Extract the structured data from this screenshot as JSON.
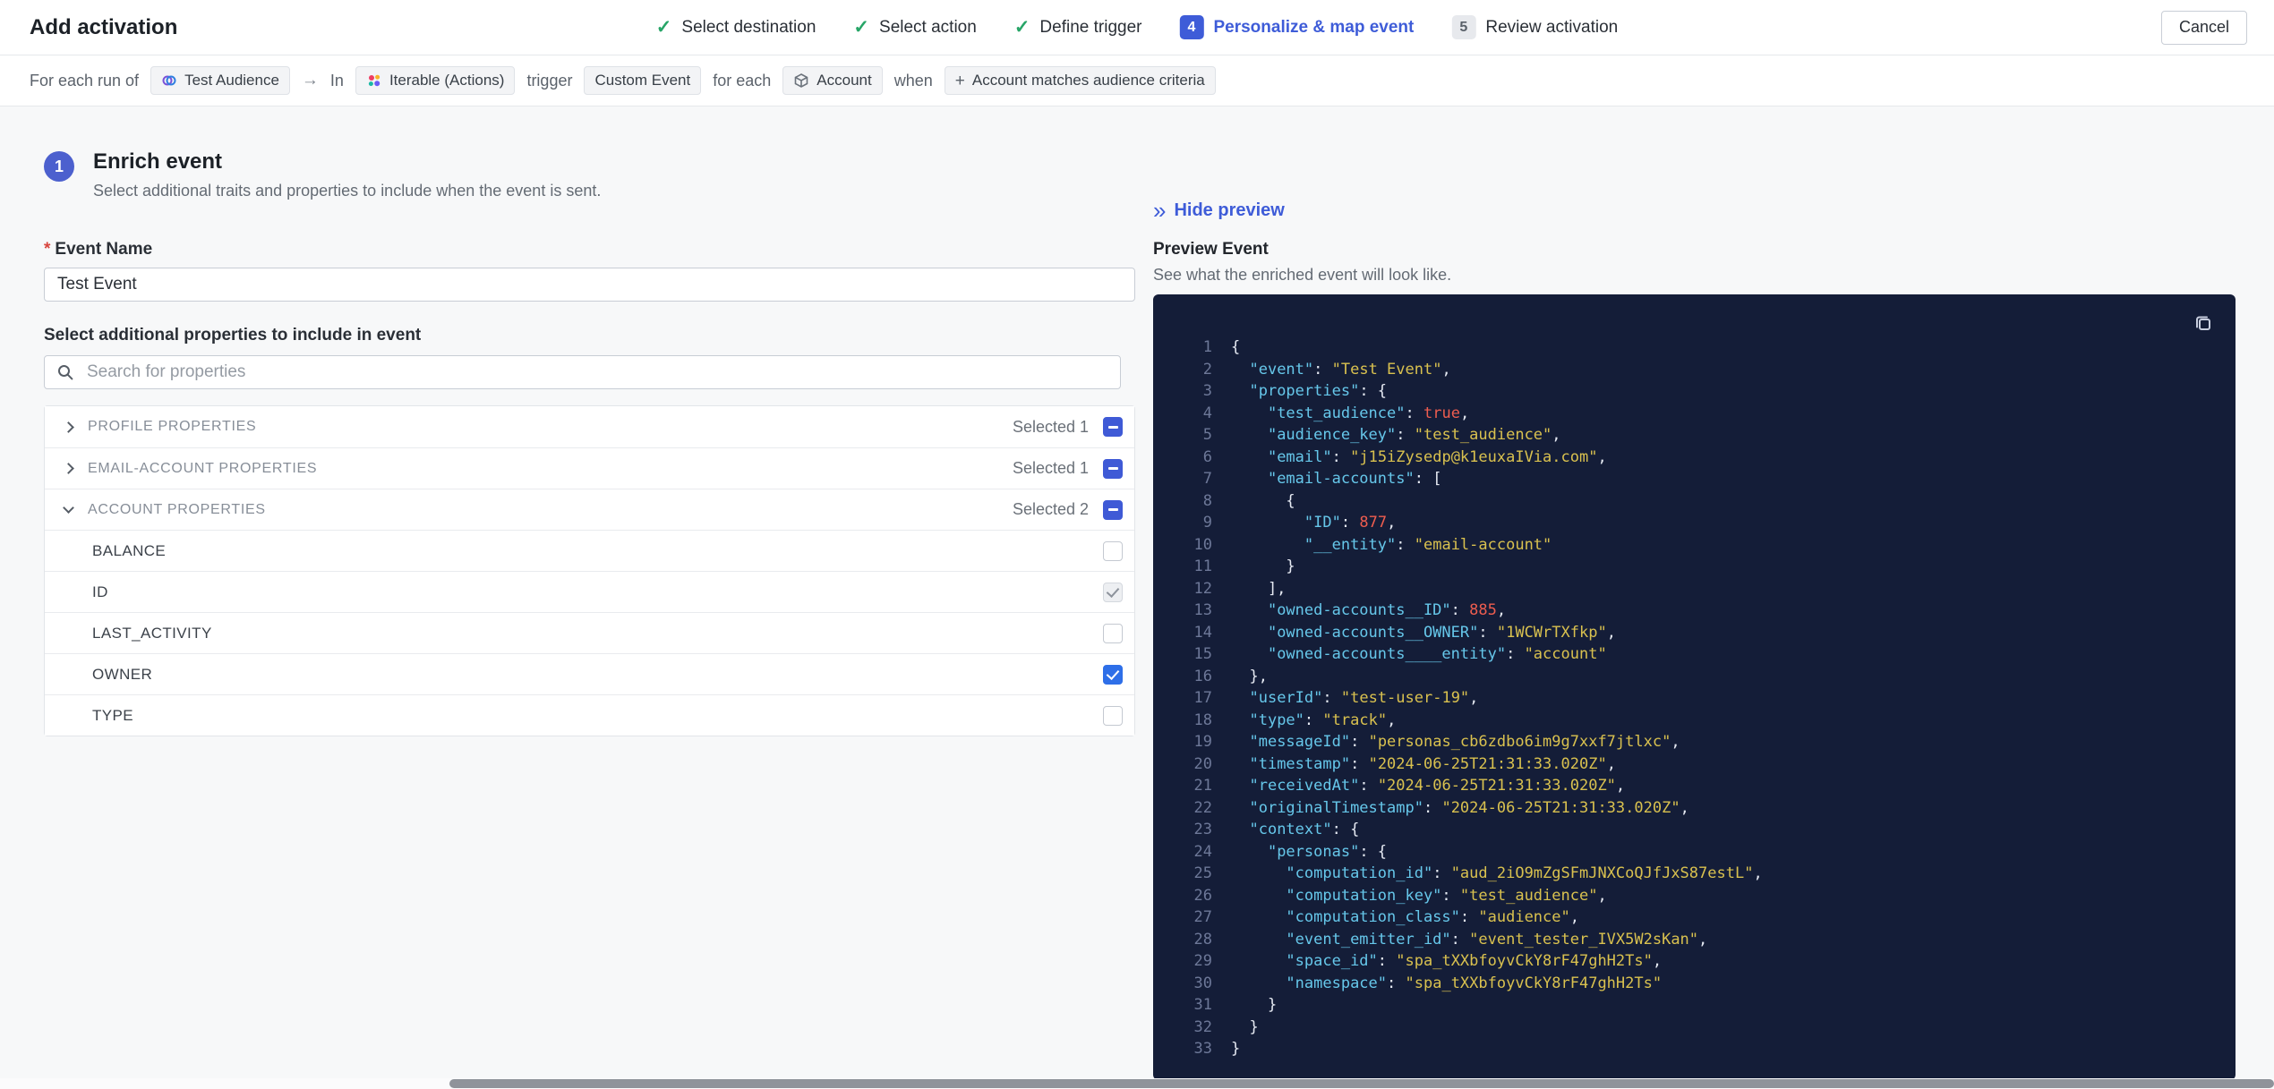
{
  "header": {
    "title": "Add activation",
    "cancel_label": "Cancel",
    "check_glyph": "✓",
    "steps": [
      {
        "label": "Select destination",
        "state": "done"
      },
      {
        "label": "Select action",
        "state": "done"
      },
      {
        "label": "Define trigger",
        "state": "done"
      },
      {
        "label": "Personalize & map event",
        "state": "active",
        "number": "4"
      },
      {
        "label": "Review activation",
        "state": "upcoming",
        "number": "5"
      }
    ]
  },
  "trigger_bar": {
    "prefix": "For each run of",
    "audience_chip": "Test Audience",
    "arrow": "→",
    "in_label": "In",
    "destination_chip": "Iterable (Actions)",
    "trigger_label": "trigger",
    "event_chip": "Custom Event",
    "for_each_label": "for each",
    "entity_chip": "Account",
    "when_label": "when",
    "criteria_plus": "+",
    "criteria_chip": "Account matches audience criteria"
  },
  "enrich": {
    "step_number": "1",
    "title": "Enrich event",
    "description": "Select additional traits and properties to include when the event is sent.",
    "event_name": {
      "required_mark": "*",
      "label": "Event Name",
      "value": "Test Event"
    },
    "properties_label": "Select additional properties to include in event",
    "search": {
      "placeholder": "Search for properties"
    },
    "groups": [
      {
        "label": "PROFILE PROPERTIES",
        "selected": "Selected 1",
        "checkbox": "indeterminate",
        "expanded": false
      },
      {
        "label": "EMAIL-ACCOUNT PROPERTIES",
        "selected": "Selected 1",
        "checkbox": "indeterminate",
        "expanded": false
      },
      {
        "label": "ACCOUNT PROPERTIES",
        "selected": "Selected 2",
        "checkbox": "indeterminate",
        "expanded": true
      }
    ],
    "account_items": [
      {
        "label": "BALANCE",
        "checkbox": "unchecked"
      },
      {
        "label": "ID",
        "checkbox": "checked-muted"
      },
      {
        "label": "LAST_ACTIVITY",
        "checkbox": "unchecked"
      },
      {
        "label": "OWNER",
        "checkbox": "checked"
      },
      {
        "label": "TYPE",
        "checkbox": "unchecked"
      }
    ]
  },
  "preview": {
    "collapse_icon": "»",
    "hide_label": "Hide preview",
    "title": "Preview Event",
    "description": "See what the enriched event will look like.",
    "code_lines": [
      "{",
      "  \"event\": \"Test Event\",",
      "  \"properties\": {",
      "    \"test_audience\": true,",
      "    \"audience_key\": \"test_audience\",",
      "    \"email\": \"j15iZysedp@k1euxaIVia.com\",",
      "    \"email-accounts\": [",
      "      {",
      "        \"ID\": 877,",
      "        \"__entity\": \"email-account\"",
      "      }",
      "    ],",
      "    \"owned-accounts__ID\": 885,",
      "    \"owned-accounts__OWNER\": \"1WCWrTXfkp\",",
      "    \"owned-accounts____entity\": \"account\"",
      "  },",
      "  \"userId\": \"test-user-19\",",
      "  \"type\": \"track\",",
      "  \"messageId\": \"personas_cb6zdbo6im9g7xxf7jtlxc\",",
      "  \"timestamp\": \"2024-06-25T21:31:33.020Z\",",
      "  \"receivedAt\": \"2024-06-25T21:31:33.020Z\",",
      "  \"originalTimestamp\": \"2024-06-25T21:31:33.020Z\",",
      "  \"context\": {",
      "    \"personas\": {",
      "      \"computation_id\": \"aud_2iO9mZgSFmJNXCoQJfJxS87estL\",",
      "      \"computation_key\": \"test_audience\",",
      "      \"computation_class\": \"audience\",",
      "      \"event_emitter_id\": \"event_tester_IVX5W2sKan\",",
      "      \"space_id\": \"spa_tXXbfoyvCkY8rF47ghH2Ts\",",
      "      \"namespace\": \"spa_tXXbfoyvCkY8rF47ghH2Ts\"",
      "    }",
      "  }",
      "}"
    ]
  },
  "colors": {
    "accent_blue": "#3e5cd8",
    "success_green": "#27a567",
    "code_background": "#141d38",
    "code_key": "#66c7ea",
    "code_string": "#d9c14f",
    "code_literal": "#ee5d4f"
  }
}
